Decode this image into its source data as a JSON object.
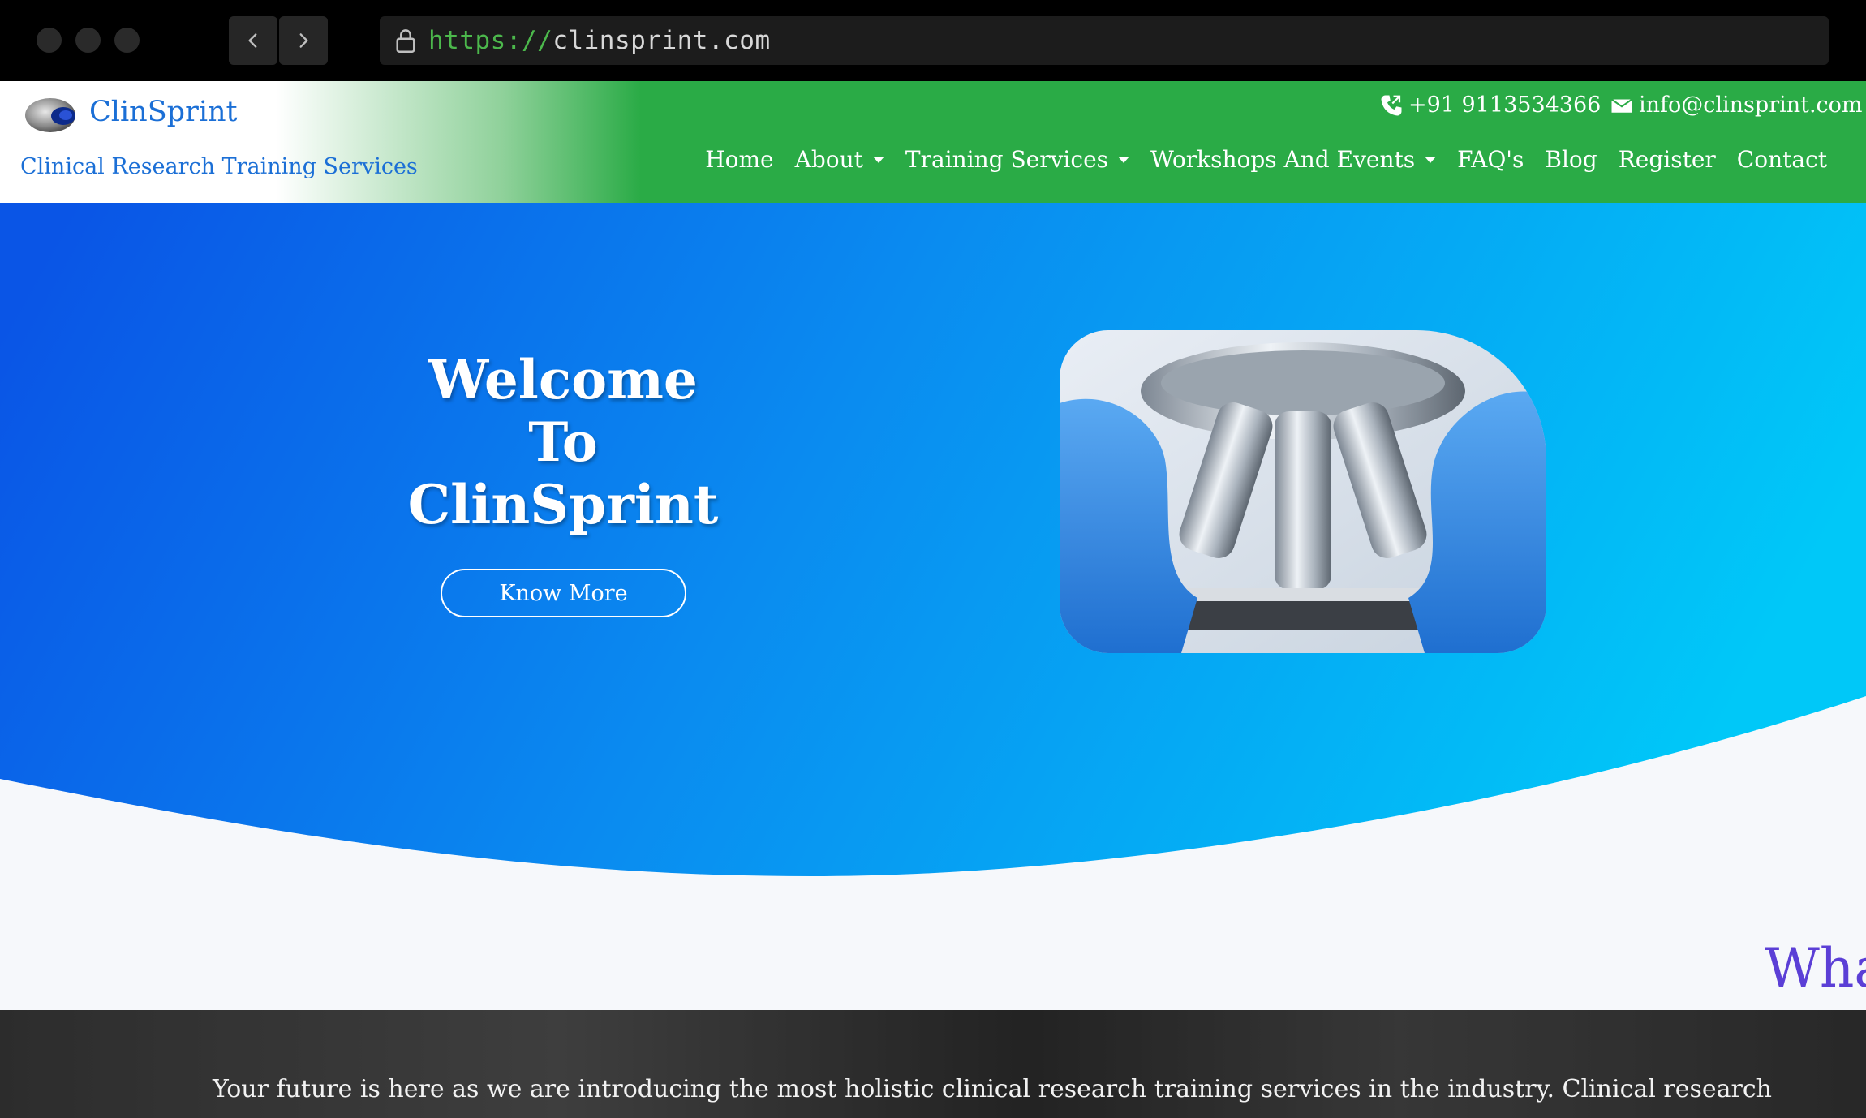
{
  "browser": {
    "url_scheme": "https://",
    "url_host": "clinsprint.com"
  },
  "header": {
    "brand": "ClinSprint",
    "tagline": "Clinical Research Training Services",
    "phone": "+91 9113534366",
    "email": "info@clinsprint.com",
    "nav": [
      {
        "label": "Home",
        "dropdown": false
      },
      {
        "label": "About",
        "dropdown": true
      },
      {
        "label": "Training Services",
        "dropdown": true
      },
      {
        "label": "Workshops And Events",
        "dropdown": true
      },
      {
        "label": "FAQ's",
        "dropdown": false
      },
      {
        "label": "Blog",
        "dropdown": false
      },
      {
        "label": "Register",
        "dropdown": false
      },
      {
        "label": "Contact",
        "dropdown": false
      }
    ]
  },
  "hero": {
    "title_lines": [
      "Welcome",
      "To",
      "ClinSprint"
    ],
    "button_label": "Know More",
    "peek_heading": "Wha"
  },
  "intro": {
    "text": "Your future is here as we are introducing the most holistic clinical research training services in the industry. Clinical research"
  },
  "colors": {
    "header_green": "#2aab46",
    "brand_blue": "#1b6fd6",
    "hero_blue_start": "#0a55e6",
    "hero_blue_end": "#00c8f8",
    "peek_purple": "#5b3fd6"
  }
}
